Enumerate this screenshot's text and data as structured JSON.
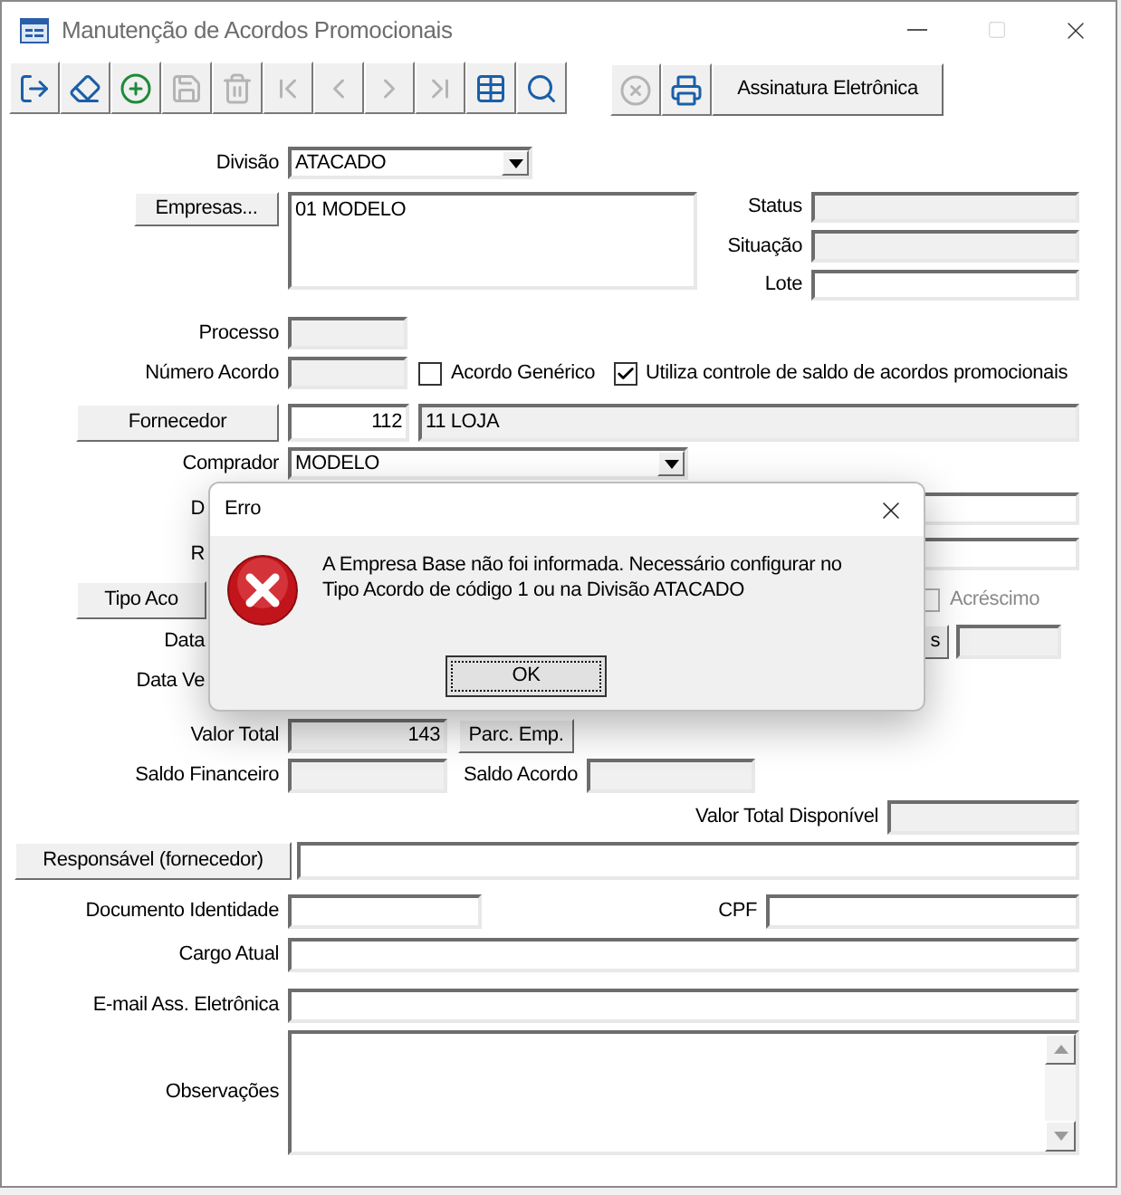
{
  "window": {
    "title": "Manutenção de Acordos Promocionais"
  },
  "toolbar": [
    {
      "kind": "exit",
      "disabled": false
    },
    {
      "kind": "clear",
      "disabled": false
    },
    {
      "kind": "add",
      "disabled": false
    },
    {
      "kind": "save",
      "disabled": true
    },
    {
      "kind": "delete",
      "disabled": true
    },
    {
      "kind": "first",
      "disabled": true
    },
    {
      "kind": "prev",
      "disabled": true
    },
    {
      "kind": "next",
      "disabled": true
    },
    {
      "kind": "last",
      "disabled": true
    },
    {
      "kind": "grid",
      "disabled": false
    },
    {
      "kind": "search",
      "disabled": false
    }
  ],
  "toolbar_right": [
    {
      "kind": "cancel",
      "disabled": true
    },
    {
      "kind": "print",
      "disabled": false
    }
  ],
  "signature_button": "Assinatura Eletrônica",
  "divisao": {
    "label": "Divisão",
    "value": "ATACADO"
  },
  "empresas": {
    "button": "Empresas...",
    "items": [
      "01 MODELO"
    ]
  },
  "status": {
    "label": "Status"
  },
  "situacao": {
    "label": "Situação"
  },
  "lote": {
    "label": "Lote"
  },
  "processo": {
    "label": "Processo"
  },
  "numero_acordo": {
    "label": "Número Acordo"
  },
  "checkboxes": [
    {
      "label": "Acordo Genérico",
      "checked": false
    },
    {
      "label": "Utiliza controle de saldo de acordos promocionais",
      "checked": true
    }
  ],
  "fornecedor": {
    "button": "Fornecedor",
    "code": "112",
    "name": "11 LOJA"
  },
  "comprador": {
    "label": "Comprador",
    "value": "MODELO"
  },
  "row_d_label": "D",
  "row_r_label": "R",
  "tipo_acordo_button": "Tipo Aco",
  "acrescimo": {
    "label": "Acréscimo",
    "checked": false,
    "disabled": true
  },
  "data_label": "Data",
  "side_button": "s",
  "data_ve_label": "Data Ve",
  "valor_total": {
    "label": "Valor Total",
    "value": "143",
    "button": "Parc. Emp."
  },
  "saldo_financeiro": {
    "label": "Saldo Financeiro"
  },
  "saldo_acordo": {
    "label": "Saldo Acordo"
  },
  "valor_total_disponivel": {
    "label": "Valor Total Disponível"
  },
  "responsavel": {
    "button": "Responsável (fornecedor)"
  },
  "documento": {
    "label": "Documento Identidade"
  },
  "cpf": {
    "label": "CPF"
  },
  "cargo": {
    "label": "Cargo Atual"
  },
  "email": {
    "label": "E-mail Ass. Eletrônica"
  },
  "observacoes": {
    "label": "Observações"
  },
  "dialog": {
    "title": "Erro",
    "message_lines": [
      "A Empresa Base não foi informada. Necessário configurar no",
      "Tipo Acordo de código 1 ou na Divisão ATACADO"
    ],
    "button": "OK"
  }
}
